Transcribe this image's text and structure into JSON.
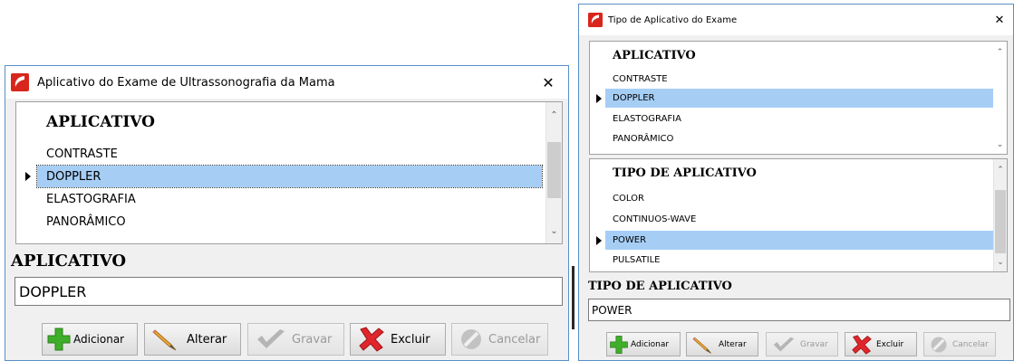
{
  "windows": [
    {
      "id": "left",
      "title": "Aplicativo do Exame de Ultrassonografia da Mama",
      "close_glyph": "✕",
      "grid": {
        "header": "APLICATIVO",
        "rows": [
          "CONTRASTE",
          "DOPPLER",
          "ELASTOGRAFIA",
          "PANORÂMICO"
        ],
        "selected_index": 1
      },
      "field": {
        "label": "APLICATIVO",
        "value": "DOPPLER"
      },
      "buttons": [
        {
          "label": "Adicionar",
          "icon": "add-icon",
          "enabled": true
        },
        {
          "label": "Alterar",
          "icon": "pencil-icon",
          "enabled": true
        },
        {
          "label": "Gravar",
          "icon": "checkmark-icon",
          "enabled": false
        },
        {
          "label": "Excluir",
          "icon": "delete-x-icon",
          "enabled": true
        },
        {
          "label": "Cancelar",
          "icon": "cancel-icon",
          "enabled": false
        }
      ]
    },
    {
      "id": "right",
      "title": "Tipo de Aplicativo do Exame",
      "close_glyph": "✕",
      "grids": [
        {
          "header": "APLICATIVO",
          "rows": [
            "CONTRASTE",
            "DOPPLER",
            "ELASTOGRAFIA",
            "PANORÂMICO"
          ],
          "selected_index": 1
        },
        {
          "header": "TIPO DE APLICATIVO",
          "rows": [
            "COLOR",
            "CONTINUOS-WAVE",
            "POWER",
            "PULSATILE"
          ],
          "selected_index": 2
        }
      ],
      "field": {
        "label": "TIPO DE APLICATIVO",
        "value": "POWER"
      },
      "buttons": [
        {
          "label": "Adicionar",
          "icon": "add-icon",
          "enabled": true
        },
        {
          "label": "Alterar",
          "icon": "pencil-icon",
          "enabled": true
        },
        {
          "label": "Gravar",
          "icon": "checkmark-icon",
          "enabled": false
        },
        {
          "label": "Excluir",
          "icon": "delete-x-icon",
          "enabled": true
        },
        {
          "label": "Cancelar",
          "icon": "cancel-icon",
          "enabled": false
        }
      ]
    }
  ],
  "colors": {
    "selection": "#a6cef5",
    "window_border": "#5a8fc8",
    "app_icon_red": "#d9261c",
    "add_green": "#3fae2a",
    "delete_red": "#e0262b"
  }
}
